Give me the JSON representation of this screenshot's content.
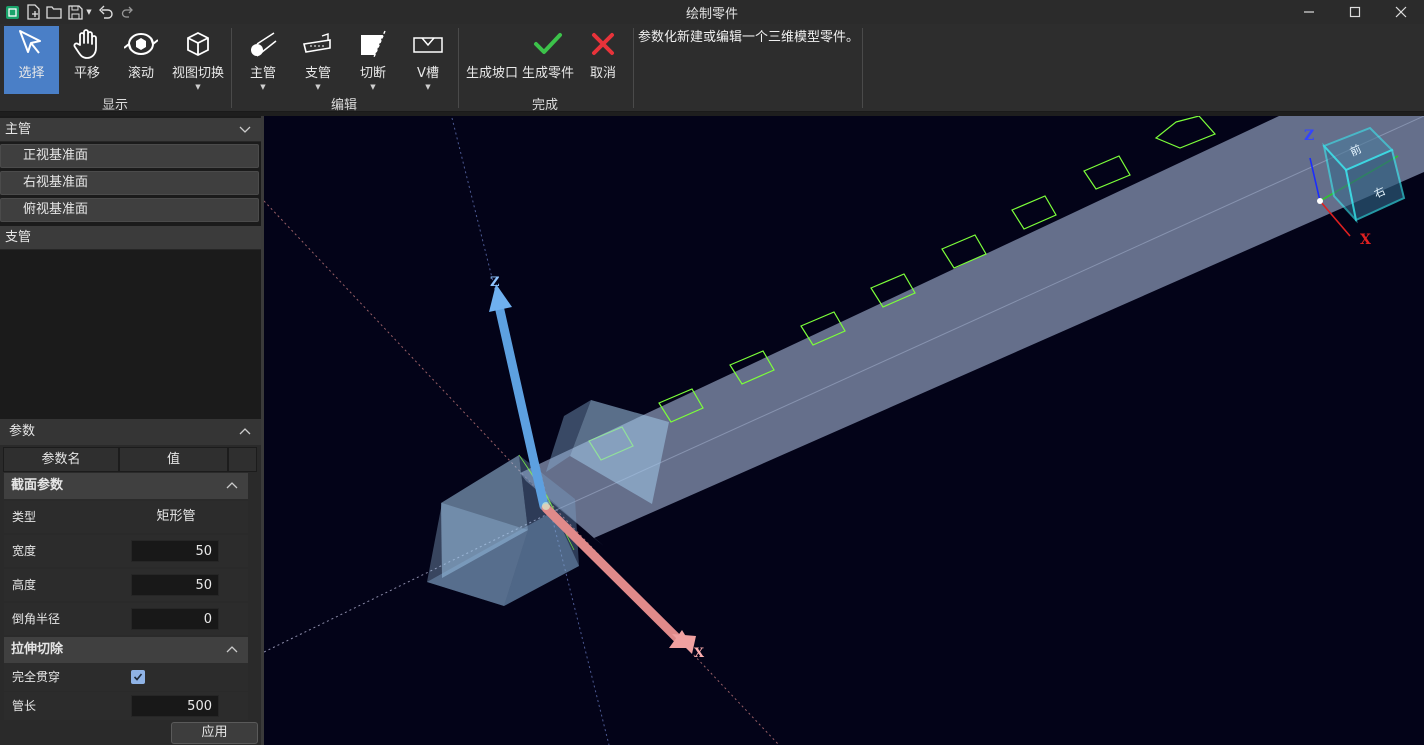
{
  "window": {
    "title": "绘制零件"
  },
  "quick_access": [
    "app-logo-icon",
    "new-file-icon",
    "open-folder-icon",
    "save-icon",
    "undo-icon",
    "redo-icon"
  ],
  "ribbon": {
    "display_group": "显示",
    "edit_group": "编辑",
    "finish_group": "完成",
    "buttons": {
      "select": "选择",
      "pan": "平移",
      "rotate": "滚动",
      "view_switch": "视图切换",
      "main_pipe": "主管",
      "branch_pipe": "支管",
      "cut": "切断",
      "v_groove": "V槽",
      "gen_bevel": "生成坡口",
      "gen_part": "生成零件",
      "cancel": "取消"
    },
    "hint": "参数化新建或编辑一个三维模型零件。"
  },
  "tree": {
    "main_pipe": "主管",
    "planes": [
      "正视基准面",
      "右视基准面",
      "俯视基准面"
    ],
    "branch_pipe": "支管"
  },
  "params": {
    "header": "参数",
    "col_name": "参数名",
    "col_value": "值",
    "section_profile": "截面参数",
    "type_label": "类型",
    "type_value": "矩形管",
    "width_label": "宽度",
    "width_value": "50",
    "height_label": "高度",
    "height_value": "50",
    "fillet_label": "倒角半径",
    "fillet_value": "0",
    "section_extrude": "拉伸切除",
    "through_label": "完全贯穿",
    "through_checked": true,
    "length_label": "管长",
    "length_value": "500",
    "apply": "应用"
  },
  "viewport": {
    "axis_z": "Z",
    "axis_x": "X",
    "cube_top": "前",
    "cube_right": "右",
    "colors": {
      "background": "#030318",
      "pipe": "#8c9ab8",
      "z_axis": "#5da0e0",
      "x_axis": "#e08a8a",
      "cut_outline": "#7cff3a",
      "cube": "#38e8f0"
    }
  }
}
